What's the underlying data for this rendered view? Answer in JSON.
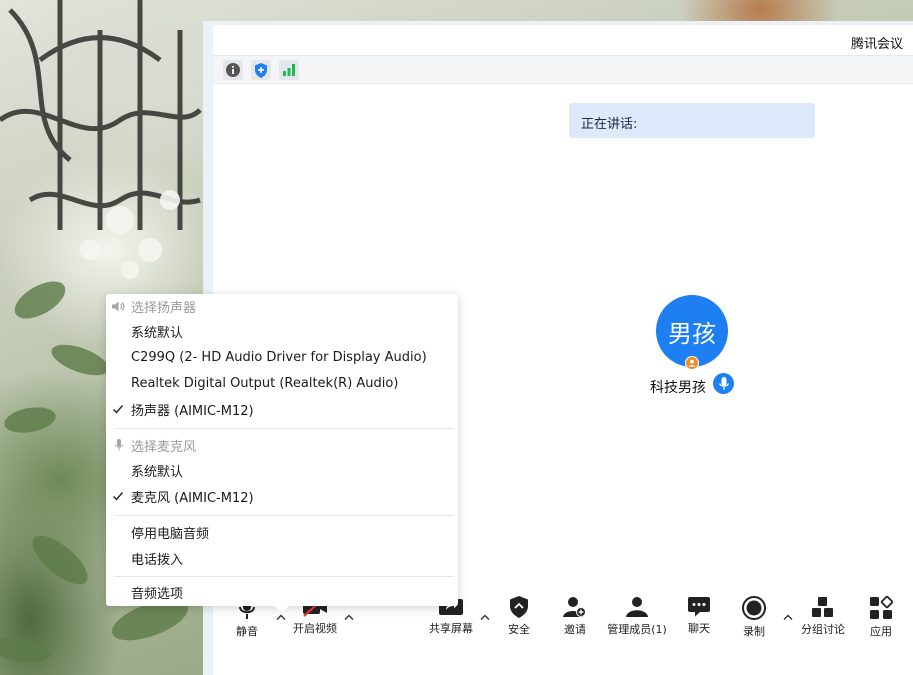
{
  "window": {
    "title": "腾讯会议"
  },
  "status_icons": [
    "info-icon",
    "shield-plus-icon",
    "signal-bars-icon"
  ],
  "speaking": {
    "label": "正在讲话:"
  },
  "participant": {
    "avatar_text": "男孩",
    "name": "科技男孩"
  },
  "audio_menu": {
    "speaker_header": "选择扬声器",
    "speakers": [
      {
        "label": "系统默认",
        "checked": false
      },
      {
        "label": "C299Q (2- HD Audio Driver for Display Audio)",
        "checked": false
      },
      {
        "label": "Realtek Digital Output (Realtek(R) Audio)",
        "checked": false
      },
      {
        "label": "扬声器 (AIMIC-M12)",
        "checked": true
      }
    ],
    "mic_header": "选择麦克风",
    "mics": [
      {
        "label": "系统默认",
        "checked": false
      },
      {
        "label": "麦克风 (AIMIC-M12)",
        "checked": true
      }
    ],
    "stop_audio": "停用电脑音频",
    "phone_dial": "电话拨入",
    "audio_options": "音频选项"
  },
  "toolbar": {
    "mute": "静音",
    "start_video": "开启视频",
    "share_screen": "共享屏幕",
    "security": "安全",
    "invite": "邀请",
    "manage_members": "管理成员(1)",
    "chat": "聊天",
    "record": "录制",
    "breakout": "分组讨论",
    "apps": "应用"
  },
  "colors": {
    "accent": "#1e7ff2",
    "speaking_bg": "#dce9fb",
    "signal": "#1db954",
    "badge": "#f08a24"
  }
}
